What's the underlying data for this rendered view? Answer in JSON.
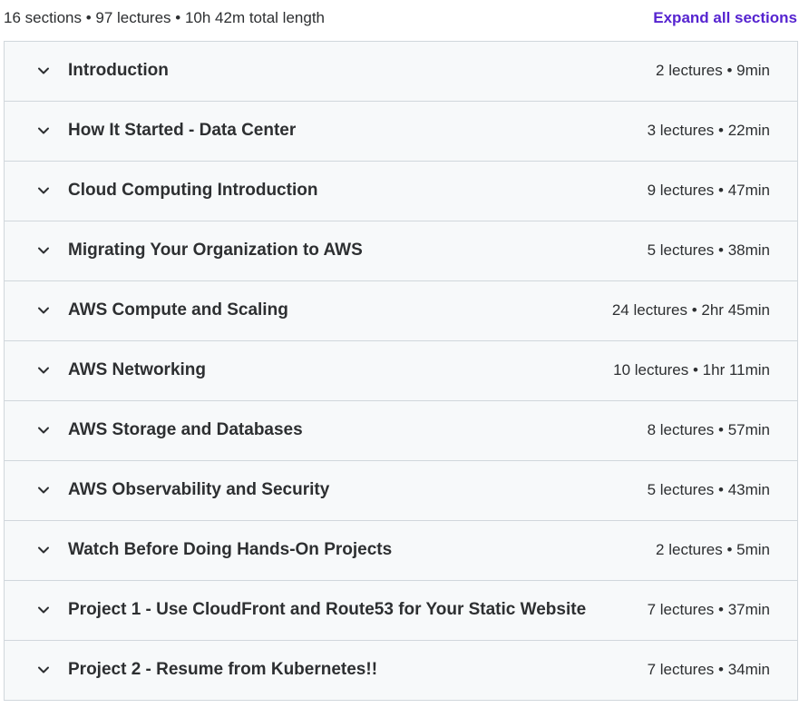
{
  "header": {
    "summary": "16 sections • 97 lectures • 10h 42m total length",
    "expand_label": "Expand all sections"
  },
  "colors": {
    "accent": "#5624d0",
    "row_bg": "#f7f9fa",
    "border": "#d1d7dc",
    "text": "#2d2f31"
  },
  "sections": [
    {
      "title": "Introduction",
      "meta": "2 lectures • 9min",
      "icon": "chevron-down-icon"
    },
    {
      "title": "How It Started - Data Center",
      "meta": "3 lectures • 22min",
      "icon": "chevron-down-icon"
    },
    {
      "title": "Cloud Computing Introduction",
      "meta": "9 lectures • 47min",
      "icon": "chevron-down-icon"
    },
    {
      "title": "Migrating Your Organization to AWS",
      "meta": "5 lectures • 38min",
      "icon": "chevron-down-icon"
    },
    {
      "title": "AWS Compute and Scaling",
      "meta": "24 lectures • 2hr 45min",
      "icon": "chevron-down-icon"
    },
    {
      "title": "AWS Networking",
      "meta": "10 lectures • 1hr 11min",
      "icon": "chevron-down-icon"
    },
    {
      "title": "AWS Storage and Databases",
      "meta": "8 lectures • 57min",
      "icon": "chevron-down-icon"
    },
    {
      "title": "AWS Observability and Security",
      "meta": "5 lectures • 43min",
      "icon": "chevron-down-icon"
    },
    {
      "title": "Watch Before Doing Hands-On Projects",
      "meta": "2 lectures • 5min",
      "icon": "chevron-down-icon"
    },
    {
      "title": "Project 1 - Use CloudFront and Route53 for Your Static Website",
      "meta": "7 lectures • 37min",
      "icon": "chevron-down-icon"
    },
    {
      "title": "Project 2 - Resume from Kubernetes!!",
      "meta": "7 lectures • 34min",
      "icon": "chevron-down-icon"
    }
  ]
}
